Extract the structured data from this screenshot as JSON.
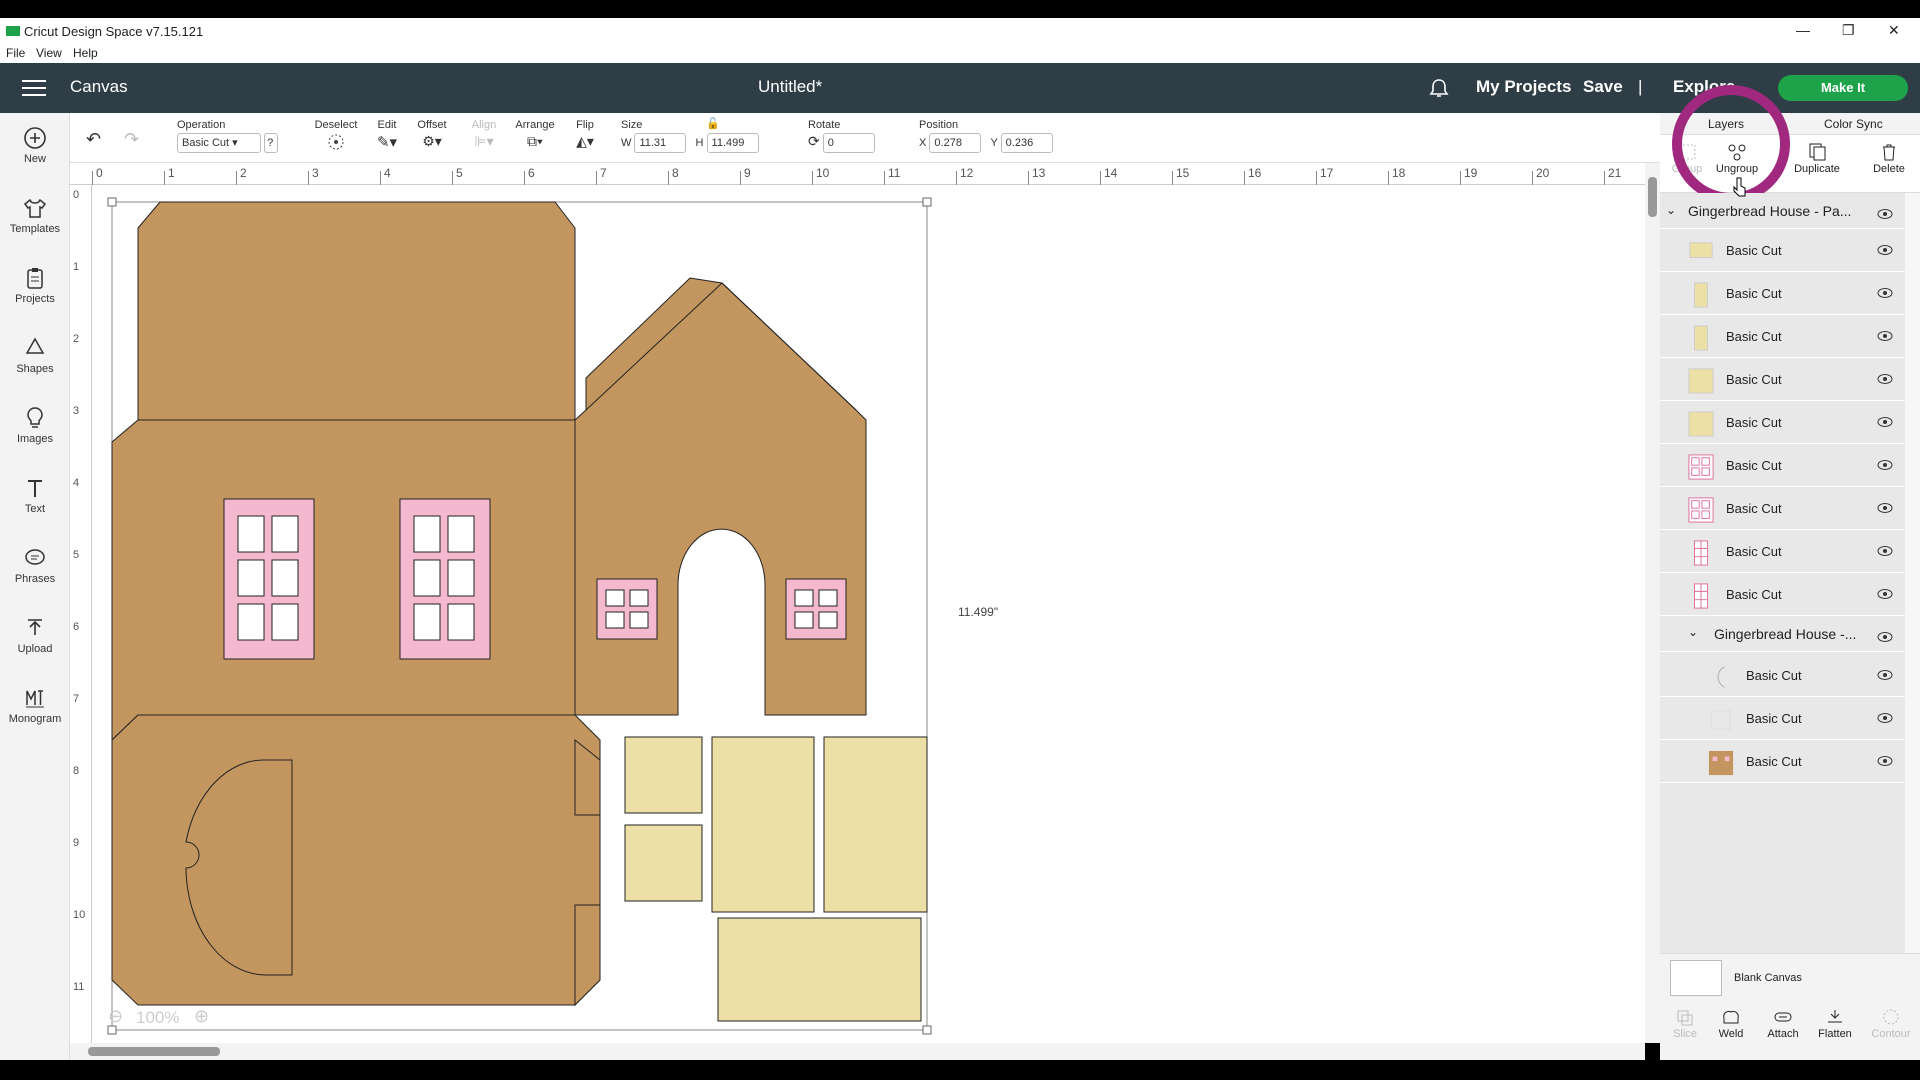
{
  "window": {
    "title": "Cricut Design Space  v7.15.121",
    "minimize": "—",
    "restore": "❐",
    "close": "✕"
  },
  "menu": {
    "file": "File",
    "view": "View",
    "help": "Help"
  },
  "header": {
    "section": "Canvas",
    "doc_title": "Untitled*",
    "my_projects": "My Projects",
    "save": "Save",
    "separator": "|",
    "explore": "Explore",
    "make_it": "Make It",
    "accent": "#1fa34a"
  },
  "nav": [
    {
      "label": "New",
      "icon": "plus-circle-icon"
    },
    {
      "label": "Templates",
      "icon": "shirt-icon"
    },
    {
      "label": "Projects",
      "icon": "clipboard-icon"
    },
    {
      "label": "Shapes",
      "icon": "shapes-icon"
    },
    {
      "label": "Images",
      "icon": "lightbulb-icon"
    },
    {
      "label": "Text",
      "icon": "text-icon"
    },
    {
      "label": "Phrases",
      "icon": "speech-icon"
    },
    {
      "label": "Upload",
      "icon": "upload-icon"
    },
    {
      "label": "Monogram",
      "icon": "monogram-icon"
    }
  ],
  "toolbar": {
    "operation_label": "Operation",
    "operation_value": "Basic Cut",
    "help": "?",
    "deselect": "Deselect",
    "edit": "Edit",
    "offset": "Offset",
    "align": "Align",
    "arrange": "Arrange",
    "flip": "Flip",
    "size": "Size",
    "w_label": "W",
    "w_value": "11.31",
    "h_label": "H",
    "h_value": "11.499",
    "rotate": "Rotate",
    "rotate_value": "0",
    "position": "Position",
    "x_label": "X",
    "x_value": "0.278",
    "y_label": "Y",
    "y_value": "0.236"
  },
  "ruler": {
    "h": [
      "0",
      "1",
      "2",
      "3",
      "4",
      "5",
      "6",
      "7",
      "8",
      "9",
      "10",
      "11",
      "12",
      "13",
      "14",
      "15",
      "16",
      "17",
      "18",
      "19",
      "20",
      "21"
    ],
    "v": [
      "0",
      "1",
      "2",
      "3",
      "4",
      "5",
      "6",
      "7",
      "8",
      "9",
      "10",
      "11"
    ]
  },
  "canvas": {
    "dimension_label": "11.499\"",
    "zoom": "100%"
  },
  "panel": {
    "tab_layers": "Layers",
    "tab_color_sync": "Color Sync",
    "tools": {
      "group": "Group",
      "ungroup": "Ungroup",
      "duplicate": "Duplicate",
      "delete": "Delete"
    },
    "group1": "Gingerbread House - Pa...",
    "group2": "Gingerbread House -...",
    "layers": [
      {
        "label": "Basic Cut",
        "thumb": "yellow-wide"
      },
      {
        "label": "Basic Cut",
        "thumb": "yellow-tall"
      },
      {
        "label": "Basic Cut",
        "thumb": "yellow-tall"
      },
      {
        "label": "Basic Cut",
        "thumb": "yellow-square"
      },
      {
        "label": "Basic Cut",
        "thumb": "yellow-square"
      },
      {
        "label": "Basic Cut",
        "thumb": "pink-window"
      },
      {
        "label": "Basic Cut",
        "thumb": "pink-window"
      },
      {
        "label": "Basic Cut",
        "thumb": "pink-window-tall"
      },
      {
        "label": "Basic Cut",
        "thumb": "pink-window-tall"
      }
    ],
    "group2_layers": [
      {
        "label": "Basic Cut",
        "thumb": "arc-outline"
      },
      {
        "label": "Basic Cut",
        "thumb": "blank"
      },
      {
        "label": "Basic Cut",
        "thumb": "brown-house"
      }
    ],
    "blank_canvas": "Blank Canvas",
    "bottom_tools": {
      "slice": "Slice",
      "weld": "Weld",
      "attach": "Attach",
      "flatten": "Flatten",
      "contour": "Contour"
    }
  },
  "colors": {
    "cardboard": "#c4965f",
    "pink": "#f4b8cf",
    "cream": "#ede0a6",
    "highlight": "#a0287e"
  }
}
